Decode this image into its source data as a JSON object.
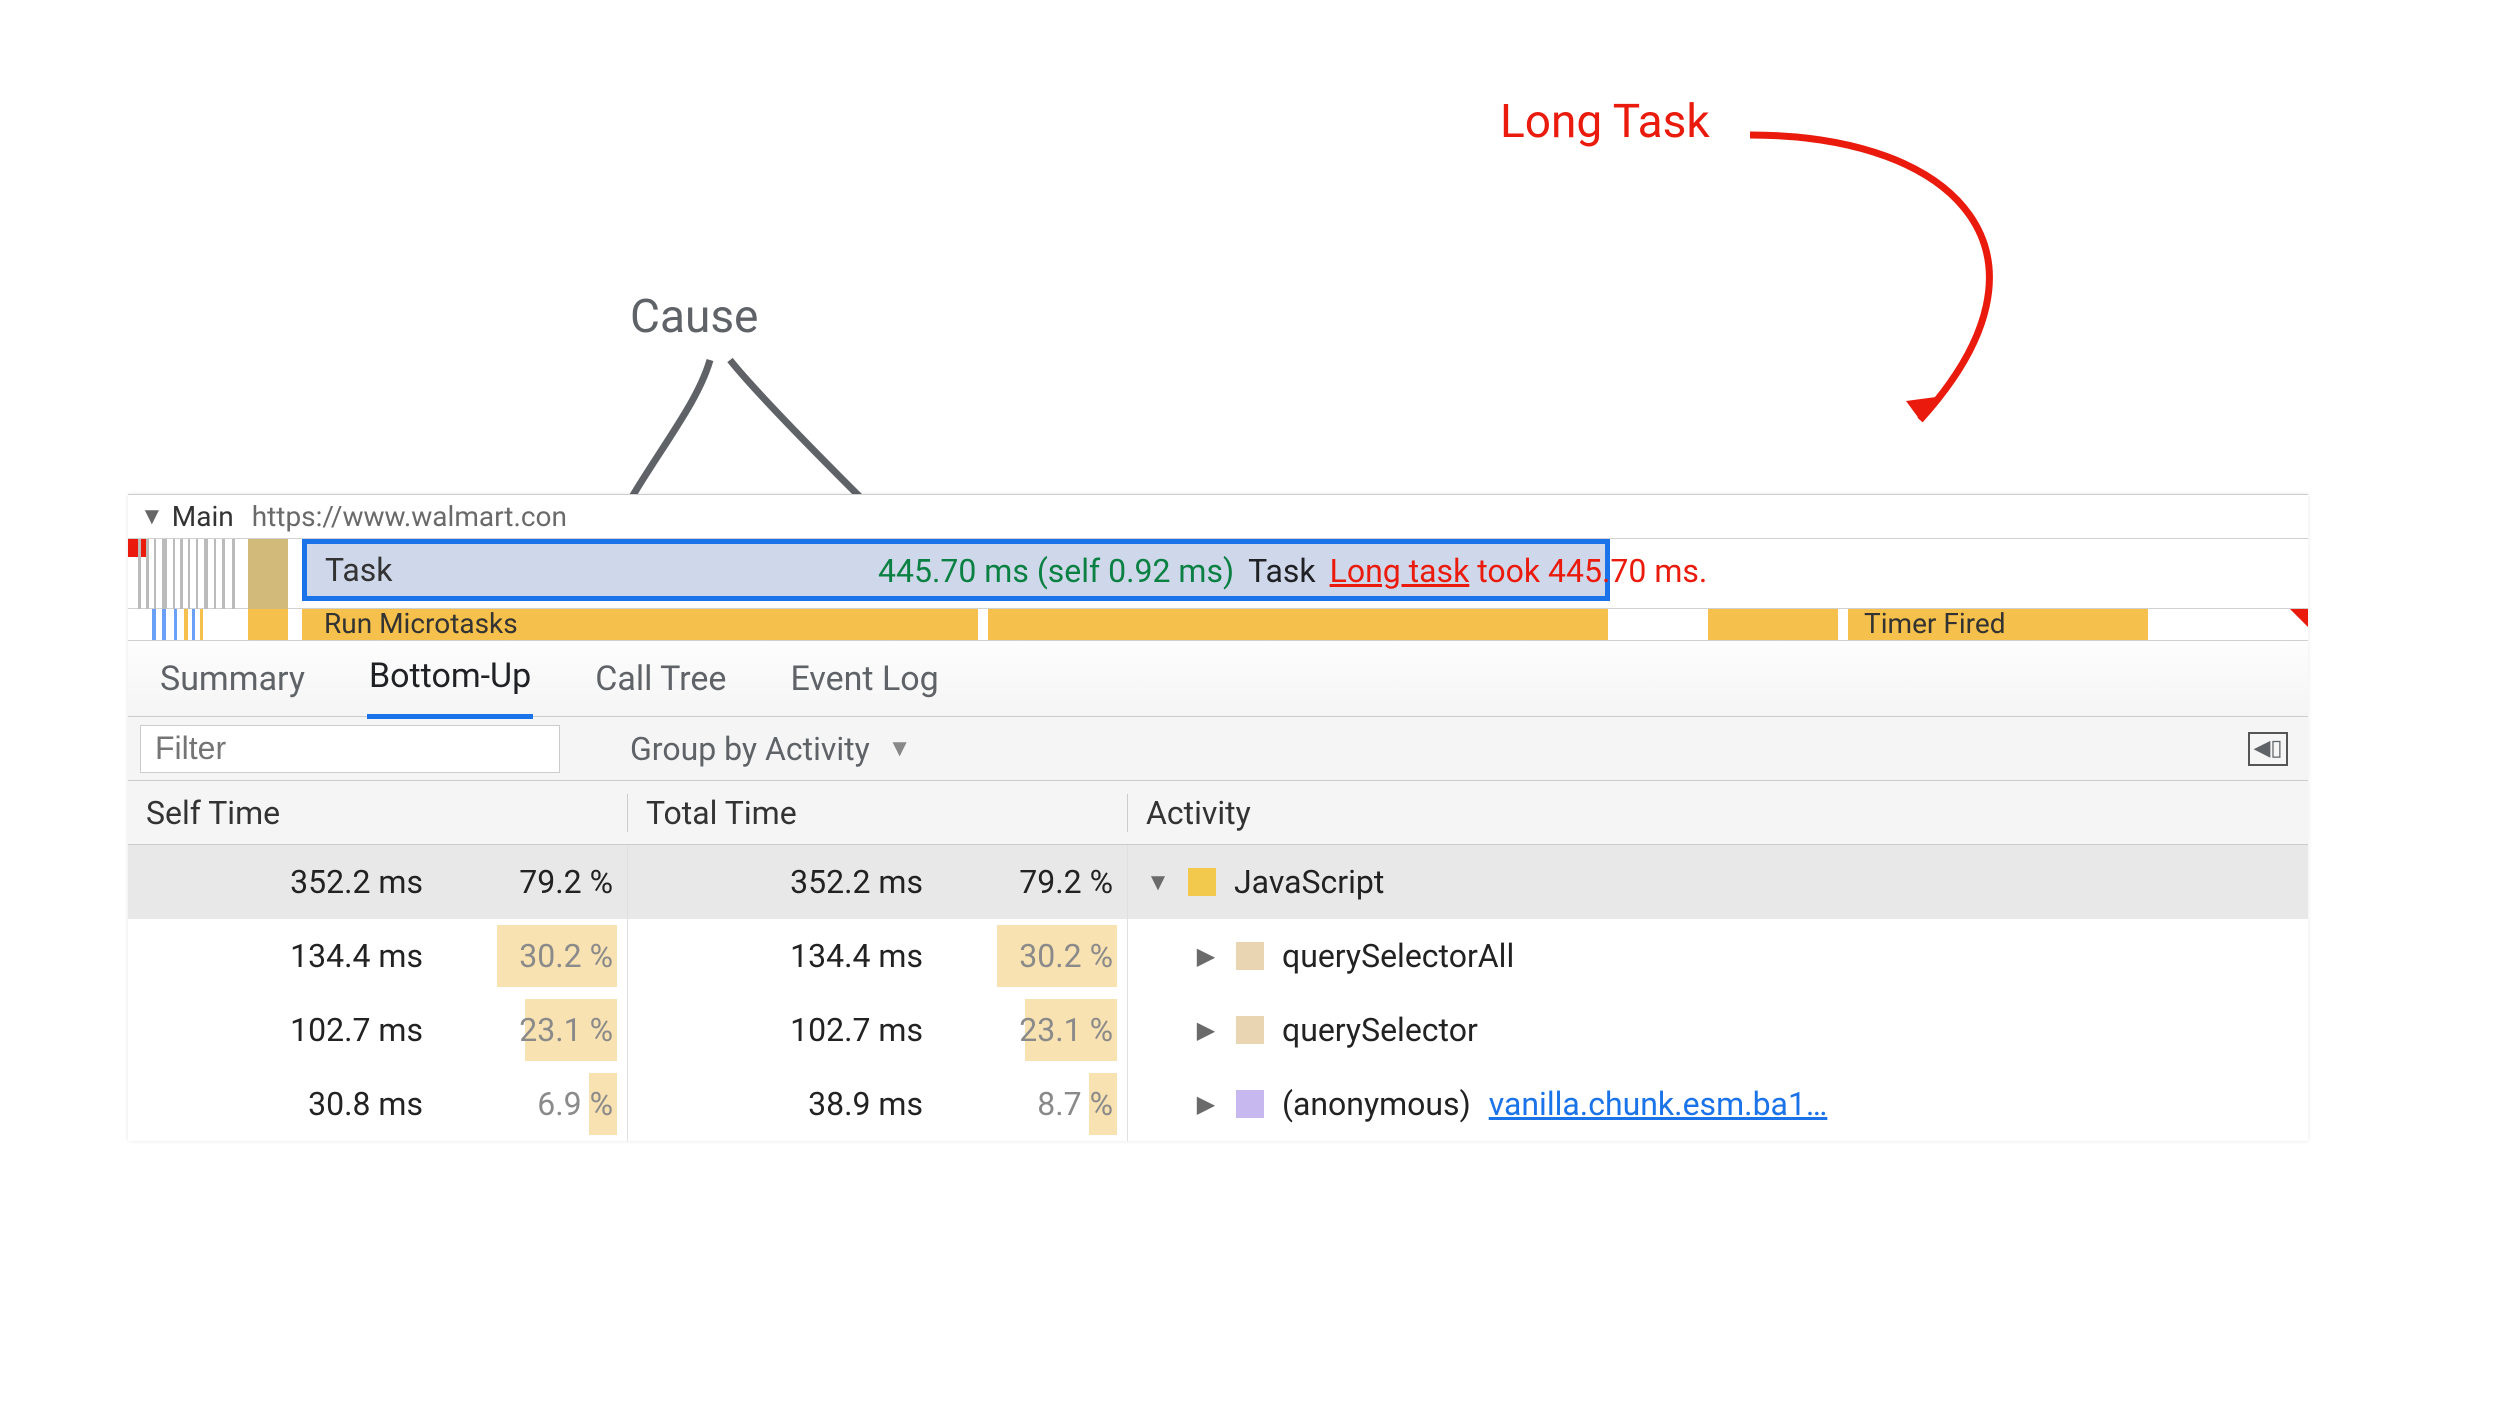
{
  "annotations": {
    "long_task": "Long Task",
    "cause": "Cause"
  },
  "thread": {
    "name": "Main",
    "url": "https://www.walmart.con"
  },
  "flame": {
    "task_label": "Task",
    "timing": "445.70 ms (self 0.92 ms)",
    "task_name": "Task",
    "long_task_prefix": "Long task",
    "long_task_suffix": " took 445.70 ms.",
    "microtasks": "Run Microtasks",
    "timer_fired": "Timer Fired"
  },
  "tabs": [
    "Summary",
    "Bottom-Up",
    "Call Tree",
    "Event Log"
  ],
  "active_tab": 1,
  "filter": {
    "placeholder": "Filter",
    "group_label": "Group by Activity"
  },
  "columns": {
    "self": "Self Time",
    "total": "Total Time",
    "activity": "Activity"
  },
  "rows": [
    {
      "self_ms": "352.2 ms",
      "self_pct": "79.2 %",
      "total_ms": "352.2 ms",
      "total_pct": "79.2 %",
      "expanded": true,
      "selected": true,
      "indent": 0,
      "swatch": "#f2c94c",
      "label": "JavaScript",
      "link": "",
      "bar": 0
    },
    {
      "self_ms": "134.4 ms",
      "self_pct": "30.2 %",
      "total_ms": "134.4 ms",
      "total_pct": "30.2 %",
      "expanded": false,
      "selected": false,
      "indent": 1,
      "swatch": "#ead5b2",
      "label": "querySelectorAll",
      "link": "",
      "bar": 120
    },
    {
      "self_ms": "102.7 ms",
      "self_pct": "23.1 %",
      "total_ms": "102.7 ms",
      "total_pct": "23.1 %",
      "expanded": false,
      "selected": false,
      "indent": 1,
      "swatch": "#ead5b2",
      "label": "querySelector",
      "link": "",
      "bar": 92
    },
    {
      "self_ms": "30.8 ms",
      "self_pct": "6.9 %",
      "total_ms": "38.9 ms",
      "total_pct": "8.7 %",
      "expanded": false,
      "selected": false,
      "indent": 1,
      "swatch": "#c7b8f0",
      "label": "(anonymous)",
      "link": "vanilla.chunk.esm.ba1…",
      "bar": 28
    }
  ]
}
